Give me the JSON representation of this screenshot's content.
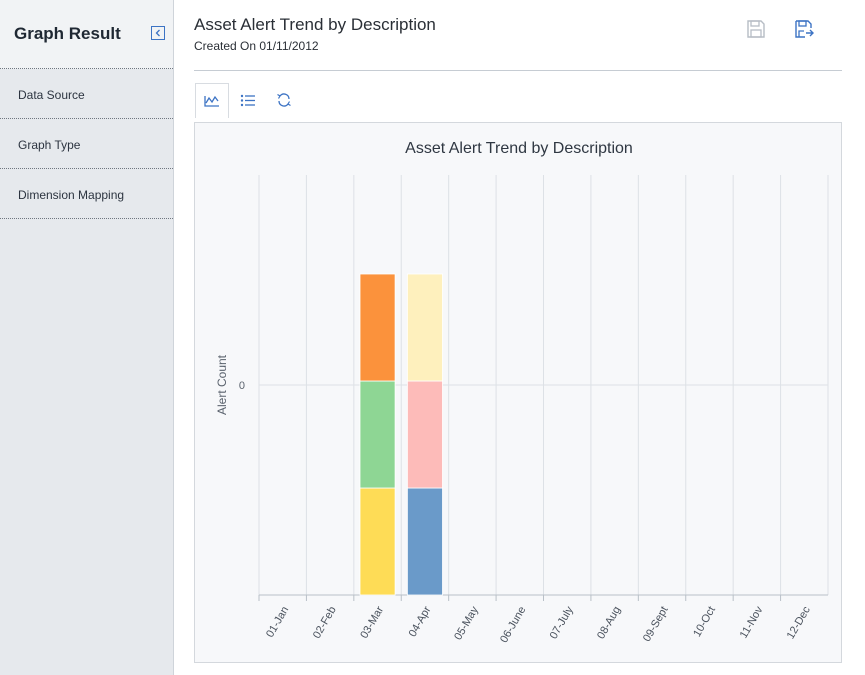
{
  "sidebar": {
    "title": "Graph Result",
    "items": [
      {
        "label": "Data Source"
      },
      {
        "label": "Graph Type"
      },
      {
        "label": "Dimension Mapping"
      }
    ]
  },
  "header": {
    "title": "Asset Alert Trend by Description",
    "created": "Created On 01/11/2012"
  },
  "icons": {
    "collapse": "chevron-left-icon",
    "save": "save-icon",
    "save_as": "save-as-icon",
    "graph": "graph-icon",
    "list": "list-icon",
    "refresh": "refresh-icon"
  },
  "colors": {
    "accent": "#3c73c4",
    "orange": "#fb923c",
    "green": "#8ed694",
    "yellow": "#fedc56",
    "light_yellow": "#fef0bd",
    "pink": "#fdbbb9",
    "blue": "#6a9ac9"
  },
  "chart_data": {
    "type": "bar",
    "stacked": true,
    "title": "Asset Alert Trend by Description",
    "ylabel": "Alert Count",
    "xlabel": "",
    "y_ticks": [
      0
    ],
    "categories": [
      "01-Jan",
      "02-Feb",
      "03-Mar",
      "04-Apr",
      "05-May",
      "06-June",
      "07-July",
      "08-Aug",
      "09-Sept",
      "10-Oct",
      "11-Nov",
      "12-Dec"
    ],
    "series": [
      {
        "color": "#fedc56",
        "values": [
          0,
          0,
          1,
          0,
          0,
          0,
          0,
          0,
          0,
          0,
          0,
          0
        ]
      },
      {
        "color": "#8ed694",
        "values": [
          0,
          0,
          1,
          0,
          0,
          0,
          0,
          0,
          0,
          0,
          0,
          0
        ]
      },
      {
        "color": "#fb923c",
        "values": [
          0,
          0,
          1,
          0,
          0,
          0,
          0,
          0,
          0,
          0,
          0,
          0
        ]
      },
      {
        "color": "#6a9ac9",
        "values": [
          0,
          0,
          0,
          1,
          0,
          0,
          0,
          0,
          0,
          0,
          0,
          0
        ]
      },
      {
        "color": "#fdbbb9",
        "values": [
          0,
          0,
          0,
          1,
          0,
          0,
          0,
          0,
          0,
          0,
          0,
          0
        ]
      },
      {
        "color": "#fef0bd",
        "values": [
          0,
          0,
          0,
          1,
          0,
          0,
          0,
          0,
          0,
          0,
          0,
          0
        ]
      }
    ],
    "grid": true,
    "legend": "none"
  }
}
